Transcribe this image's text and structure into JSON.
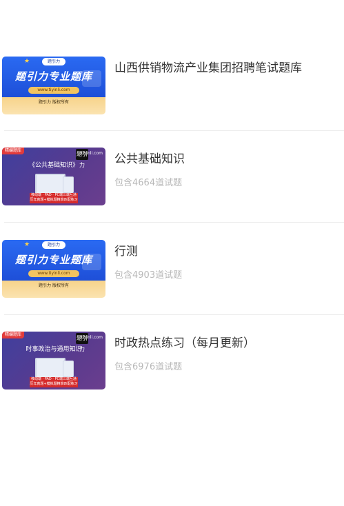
{
  "items": [
    {
      "title": "山西供销物流产业集团招聘笔试题库",
      "subtitle": "",
      "thumb_style": "brand",
      "thumb": {
        "logo_text": "题引力",
        "headline": "题引力专业题库",
        "url": "www.tiyinli.com",
        "footer": "题引力 版权所有"
      }
    },
    {
      "title": "公共基础知识",
      "subtitle": "包含4664道试题",
      "thumb_style": "course",
      "thumb": {
        "tag": "精编题库",
        "brand_mark": "题引力",
        "site": "tiyinli.com",
        "course_title": "《公共基础知识》",
        "band_line1": "移动端 · PAD · PC端三端互通",
        "band_line2": "历年真题+模拟题精准匹配练习"
      }
    },
    {
      "title": "行测",
      "subtitle": "包含4903道试题",
      "thumb_style": "brand",
      "thumb": {
        "logo_text": "题引力",
        "headline": "题引力专业题库",
        "url": "www.tiyinli.com",
        "footer": "题引力 版权所有"
      }
    },
    {
      "title": "时政热点练习（每月更新）",
      "subtitle": "包含6976道试题",
      "thumb_style": "course",
      "thumb": {
        "tag": "精编题库",
        "brand_mark": "题引力",
        "site": "tiyinli.com",
        "course_title": "时事政治与通用知识",
        "band_line1": "移动端 · PAD · PC端三端互通",
        "band_line2": "历年真题+模拟题精准匹配练习"
      }
    }
  ]
}
